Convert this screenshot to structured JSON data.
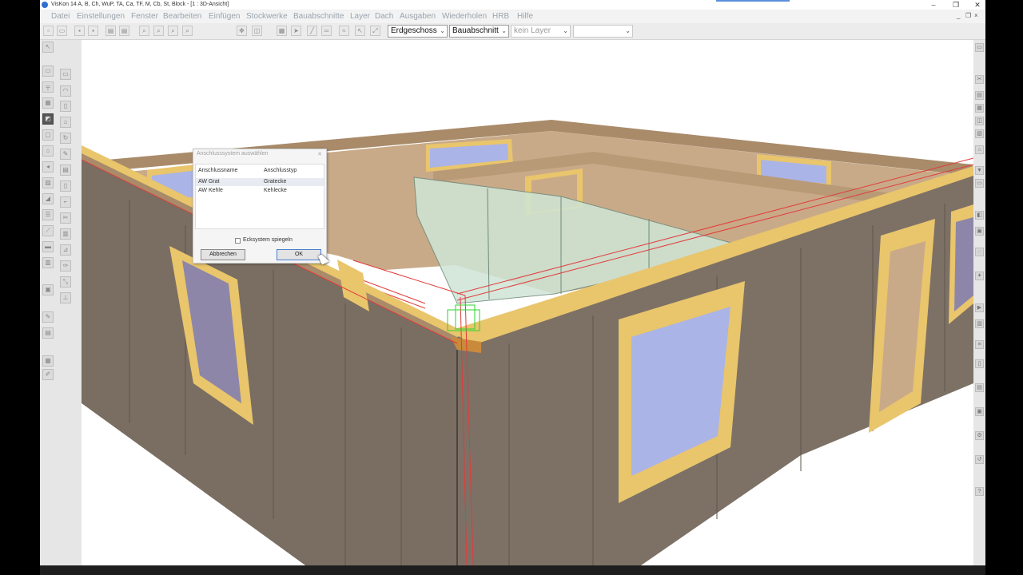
{
  "window": {
    "title": "VisKon 14 A, B, Ch, WuP, TA, Ca, TF, M, Cb, St, Block - [1 : 3D-Ansicht]",
    "controls": [
      "–",
      "❐",
      "✕"
    ],
    "mdi_controls": [
      "_",
      "❐",
      "×"
    ]
  },
  "menu": [
    "Datei",
    "Einstellungen",
    "Fenster",
    "Bearbeiten",
    "Einfügen",
    "Stockwerke",
    "Bauabschnitte",
    "Layer",
    "Dach",
    "Ausgaben",
    "Wiederholen",
    "HRB",
    "Hilfe"
  ],
  "toolbar": {
    "storey": "Erdgeschoss",
    "section": "Bauabschnitt",
    "layer": "kein Layer",
    "extra": ""
  },
  "dialog": {
    "title": "Anschlusssystem auswählen",
    "close": "✕",
    "columns": [
      "Anschlussname",
      "Anschlusstyp"
    ],
    "rows": [
      {
        "name": "AW Grat",
        "type": "Gratecke"
      },
      {
        "name": "AW Kehle",
        "type": "Kehlecke"
      }
    ],
    "checkbox_label": "Ecksystem spiegeln",
    "cancel_label": "Abbrechen",
    "ok_label": "OK"
  },
  "colors": {
    "wall_face": "#7a6e62",
    "wall_top": "#a98b6a",
    "osb_interior": "#c9aa88",
    "timber_frame": "#e9c56c",
    "glass": "#aab4e6",
    "axis_line": "#e23b3b",
    "glass_partition": "#cfe5d6"
  }
}
